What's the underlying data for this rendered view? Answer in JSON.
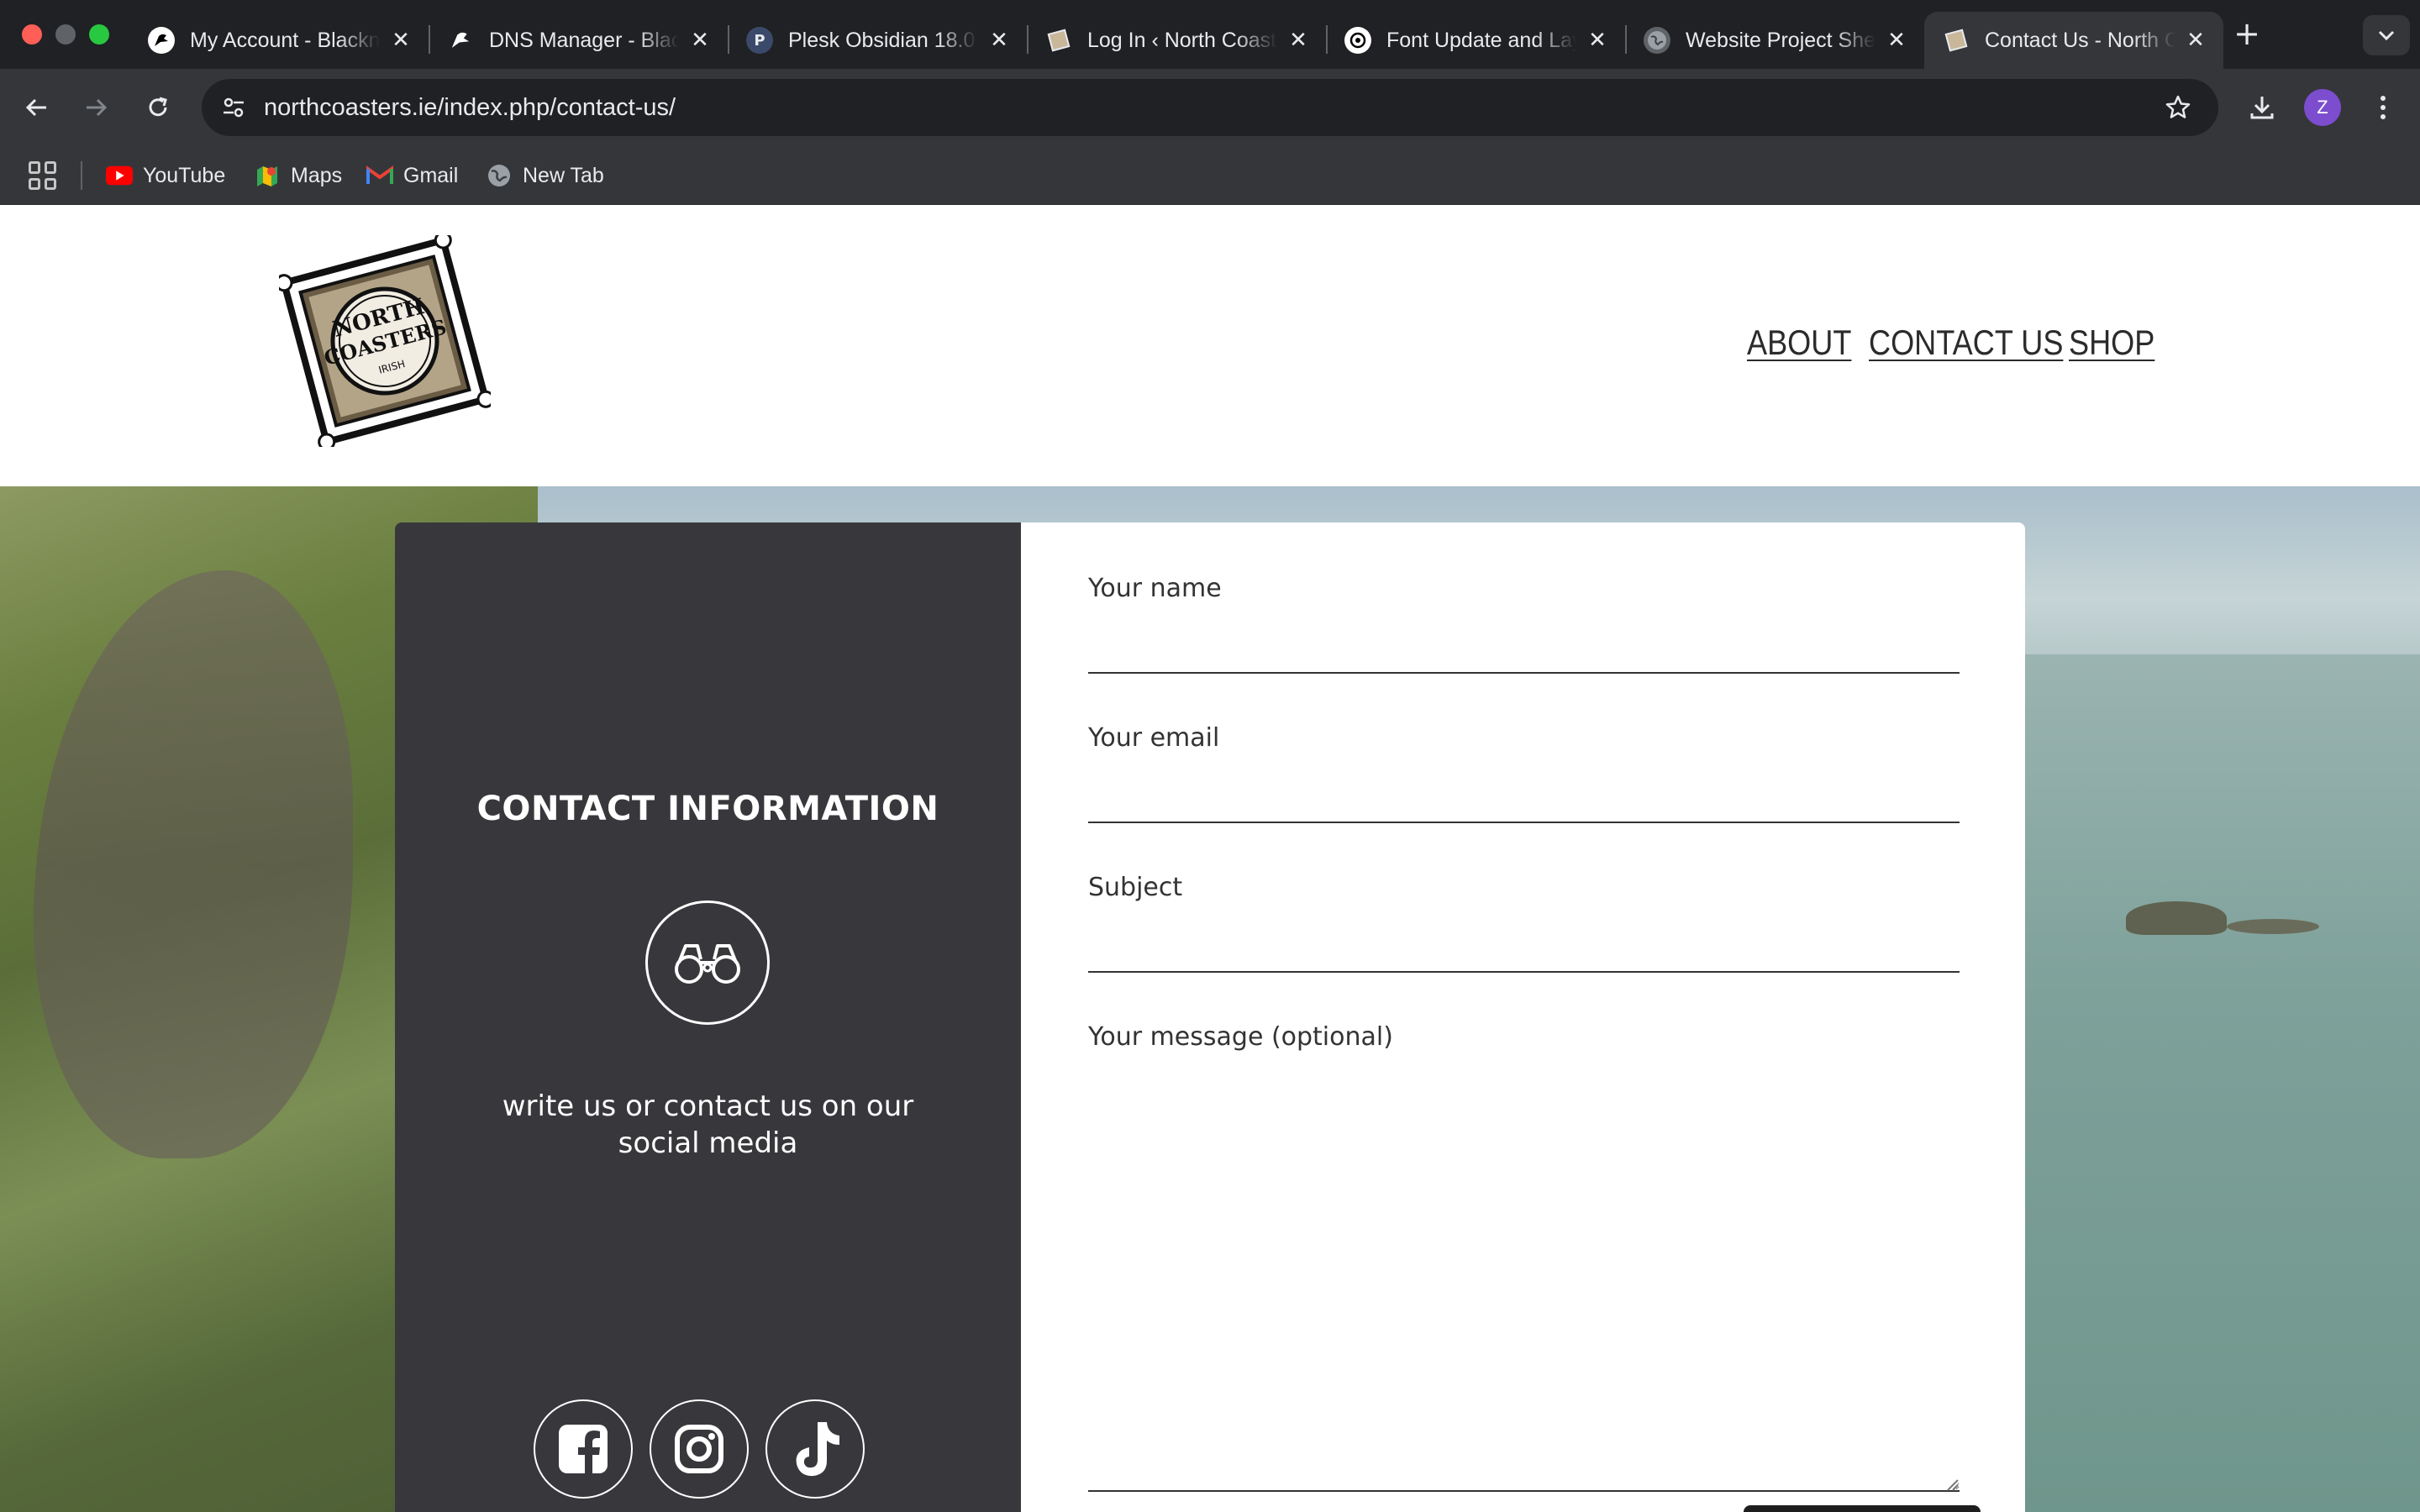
{
  "browser": {
    "tabs": [
      {
        "title": "My Account - Blacknight",
        "favicon": "blacknight-icon",
        "active": false
      },
      {
        "title": "DNS Manager - Blacknight",
        "favicon": "blacknight-icon",
        "active": false
      },
      {
        "title": "Plesk Obsidian 18.0",
        "favicon": "plesk-icon",
        "favicon_letter": "P",
        "active": false
      },
      {
        "title": "Log In ‹ North Coasters",
        "favicon": "northcoasters-icon",
        "active": false
      },
      {
        "title": "Font Update and Layout",
        "favicon": "chatgpt-icon",
        "active": false
      },
      {
        "title": "Website Project Sheet",
        "favicon": "globe-icon",
        "active": false
      },
      {
        "title": "Contact Us - North Coasters",
        "favicon": "northcoasters-icon",
        "active": true
      }
    ],
    "url": "northcoasters.ie/index.php/contact-us/",
    "profile_initial": "Z",
    "bookmarks": [
      {
        "label": "YouTube",
        "icon": "youtube-icon"
      },
      {
        "label": "Maps",
        "icon": "maps-icon"
      },
      {
        "label": "Gmail",
        "icon": "gmail-icon"
      },
      {
        "label": "New Tab",
        "icon": "globe-icon"
      }
    ]
  },
  "site": {
    "logo": {
      "line1": "NORTH",
      "line2": "COASTERS",
      "line3": "IRISH"
    },
    "nav": [
      {
        "label": "ABOUT"
      },
      {
        "label": "CONTACT US"
      },
      {
        "label": "SHOP"
      }
    ]
  },
  "contact": {
    "info_title": "CONTACT INFORMATION",
    "info_text": "write us or contact us on our social media",
    "socials": [
      {
        "name": "facebook-icon"
      },
      {
        "name": "instagram-icon"
      },
      {
        "name": "tiktok-icon"
      }
    ],
    "form": {
      "name_label": "Your name",
      "name_value": "",
      "email_label": "Your email",
      "email_value": "",
      "subject_label": "Subject",
      "subject_value": "",
      "message_label": "Your message (optional)",
      "message_value": ""
    }
  },
  "colors": {
    "chrome_bg": "#202124",
    "toolbar_bg": "#35363a",
    "panel_dark": "#38383c",
    "text_dark": "#333333",
    "avatar": "#7c4dcf"
  }
}
